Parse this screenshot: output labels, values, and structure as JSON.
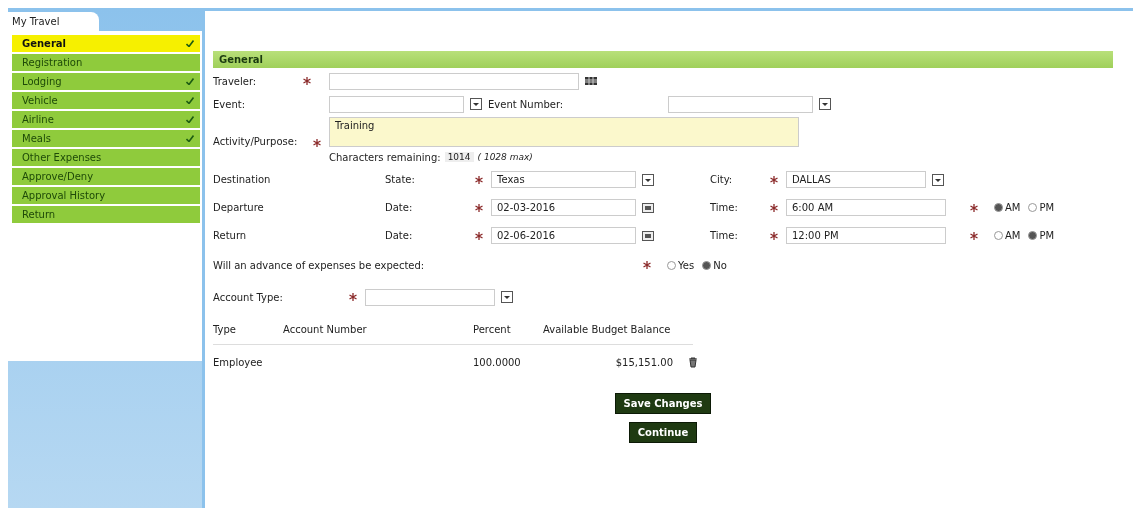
{
  "tab": {
    "label": "My Travel",
    "selected": true
  },
  "sidebar": {
    "items": [
      {
        "label": "General",
        "selected": true,
        "checked": true
      },
      {
        "label": "Registration",
        "selected": false,
        "checked": false
      },
      {
        "label": "Lodging",
        "selected": false,
        "checked": true
      },
      {
        "label": "Vehicle",
        "selected": false,
        "checked": true
      },
      {
        "label": "Airline",
        "selected": false,
        "checked": true
      },
      {
        "label": "Meals",
        "selected": false,
        "checked": true
      },
      {
        "label": "Other Expenses",
        "selected": false,
        "checked": false
      },
      {
        "label": "Approve/Deny",
        "selected": false,
        "checked": false
      },
      {
        "label": "Approval History",
        "selected": false,
        "checked": false
      },
      {
        "label": "Return",
        "selected": false,
        "checked": false
      }
    ]
  },
  "section": {
    "title": "General"
  },
  "traveler": {
    "label": "Traveler:",
    "required": true
  },
  "event": {
    "label": "Event:",
    "number_label": "Event Number:"
  },
  "activity": {
    "label": "Activity/Purpose:",
    "required": true,
    "value": "Training",
    "remaining_label": "Characters remaining:",
    "remaining": "1014",
    "max": "( 1028 max)"
  },
  "trip_rows": [
    {
      "label": "Destination",
      "fields": [
        {
          "label": "State:",
          "value": "Texas",
          "kind": "select",
          "required": true
        },
        {
          "label": "City:",
          "value": "DALLAS",
          "kind": "select",
          "required": true
        }
      ]
    },
    {
      "label": "Departure",
      "fields": [
        {
          "label": "Date:",
          "value": "02-03-2016",
          "kind": "date",
          "required": true
        },
        {
          "label": "Time:",
          "value": "6:00 AM",
          "kind": "time",
          "required": true
        }
      ],
      "period_required": true,
      "options": [
        {
          "label": "AM",
          "selected": true
        },
        {
          "label": "PM",
          "selected": false
        }
      ]
    },
    {
      "label": "Return",
      "fields": [
        {
          "label": "Date:",
          "value": "02-06-2016",
          "kind": "date",
          "required": true
        },
        {
          "label": "Time:",
          "value": "12:00 PM",
          "kind": "time",
          "required": true
        }
      ],
      "period_required": true,
      "options": [
        {
          "label": "AM",
          "selected": false
        },
        {
          "label": "PM",
          "selected": true
        }
      ]
    }
  ],
  "advance": {
    "question": "Will an advance of expenses be expected:",
    "required": true,
    "options": [
      {
        "label": "Yes",
        "selected": false
      },
      {
        "label": "No",
        "selected": true
      }
    ]
  },
  "account_type": {
    "label": "Account Type:",
    "required": true
  },
  "accounts": {
    "columns": [
      "Type",
      "Account Number",
      "Percent",
      "Available Budget Balance"
    ],
    "rows": [
      {
        "type": "Employee",
        "percent": "100.0000",
        "balance": "$15,151.00"
      }
    ]
  },
  "buttons": [
    "Save Changes",
    "Continue"
  ]
}
